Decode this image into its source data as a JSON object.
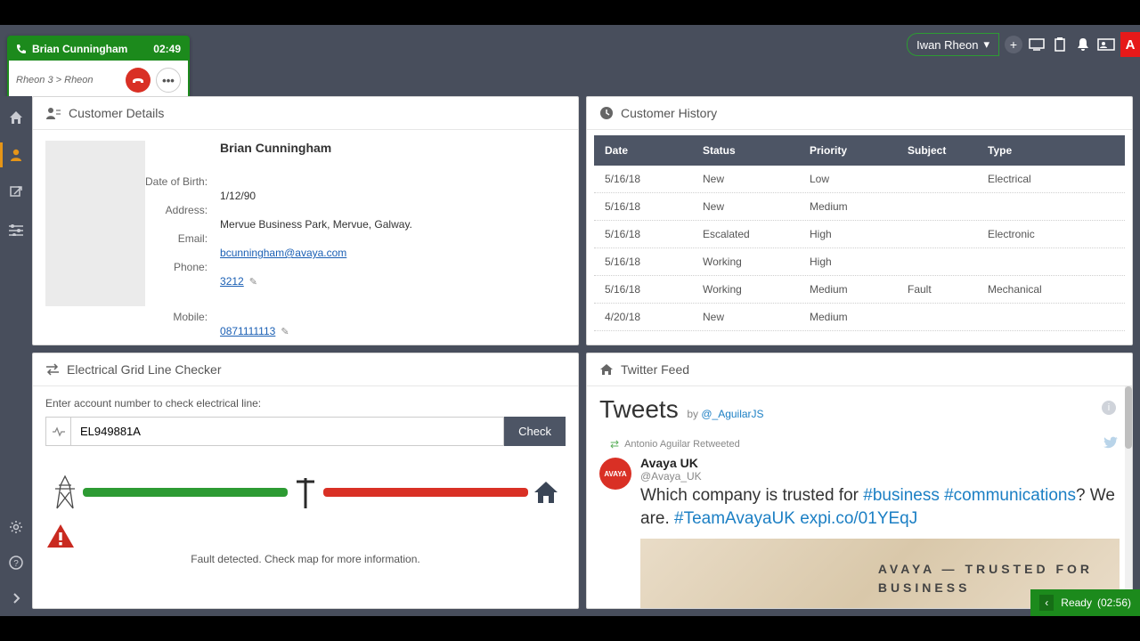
{
  "user": {
    "name": "Iwan Rheon"
  },
  "call": {
    "name": "Brian Cunningham",
    "timer": "02:49",
    "breadcrumb": "Rheon 3 > Rheon"
  },
  "customer_details": {
    "title": "Customer Details",
    "name": "Brian Cunningham",
    "labels": {
      "dob": "Date of Birth:",
      "address": "Address:",
      "email": "Email:",
      "phone": "Phone:",
      "mobile": "Mobile:"
    },
    "dob": "1/12/90",
    "address": "Mervue Business Park, Mervue, Galway.",
    "email": "bcunningham@avaya.com",
    "phone": "3212",
    "mobile": "0871111113"
  },
  "history": {
    "title": "Customer History",
    "headers": {
      "date": "Date",
      "status": "Status",
      "priority": "Priority",
      "subject": "Subject",
      "type": "Type"
    },
    "rows": [
      {
        "date": "5/16/18",
        "status": "New",
        "priority": "Low",
        "subject": "",
        "type": "Electrical"
      },
      {
        "date": "5/16/18",
        "status": "New",
        "priority": "Medium",
        "subject": "",
        "type": ""
      },
      {
        "date": "5/16/18",
        "status": "Escalated",
        "priority": "High",
        "subject": "",
        "type": "Electronic"
      },
      {
        "date": "5/16/18",
        "status": "Working",
        "priority": "High",
        "subject": "",
        "type": ""
      },
      {
        "date": "5/16/18",
        "status": "Working",
        "priority": "Medium",
        "subject": "Fault",
        "type": "Mechanical"
      },
      {
        "date": "4/20/18",
        "status": "New",
        "priority": "Medium",
        "subject": "",
        "type": ""
      }
    ]
  },
  "checker": {
    "title": "Electrical Grid Line Checker",
    "label": "Enter account number to check electrical line:",
    "value": "EL949881A",
    "button": "Check",
    "fault": "Fault detected. Check map for more information."
  },
  "twitter": {
    "title": "Twitter Feed",
    "tweets_label": "Tweets",
    "by_prefix": "by ",
    "by_handle": "@_AguilarJS",
    "retweet_line": "Antonio Aguilar Retweeted",
    "account_name": "Avaya UK",
    "account_handle": "@Avaya_UK",
    "avatar_text": "AVAYA",
    "text_p1": "Which company is trusted for ",
    "hash1": "#business",
    "hash2": "#communications",
    "text_p2": "? We are. ",
    "hash3": "#TeamAvayaUK",
    "link": "expi.co/01YEqJ",
    "img_line1": "AVAYA — TRUSTED FOR",
    "img_line2": "BUSINESS"
  },
  "ready": {
    "label": "Ready",
    "timer": "(02:56)"
  }
}
